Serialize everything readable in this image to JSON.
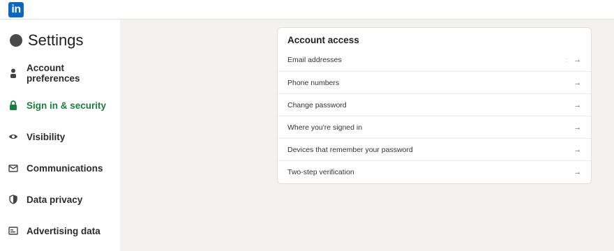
{
  "brand": {
    "logo_text": "in",
    "logo_color": "#0a66c2"
  },
  "sidebar": {
    "title": "Settings",
    "items": [
      {
        "label": "Account preferences",
        "icon": "person-icon",
        "active": false
      },
      {
        "label": "Sign in & security",
        "icon": "lock-icon",
        "active": true
      },
      {
        "label": "Visibility",
        "icon": "eye-icon",
        "active": false
      },
      {
        "label": "Communications",
        "icon": "envelope-icon",
        "active": false
      },
      {
        "label": "Data privacy",
        "icon": "shield-icon",
        "active": false
      },
      {
        "label": "Advertising data",
        "icon": "ad-card-icon",
        "active": false
      }
    ]
  },
  "main": {
    "section_title": "Account access",
    "rows": [
      {
        "label": "Email addresses",
        "arrow": "→",
        "extra": ":"
      },
      {
        "label": "Phone numbers",
        "arrow": "→"
      },
      {
        "label": "Change password",
        "arrow": "→"
      },
      {
        "label": "Where you're signed in",
        "arrow": "→"
      },
      {
        "label": "Devices that remember your password",
        "arrow": "→"
      },
      {
        "label": "Two-step verification",
        "arrow": "→"
      }
    ]
  },
  "colors": {
    "accent_active": "#1a7f3c",
    "background": "#f4f2ee"
  }
}
